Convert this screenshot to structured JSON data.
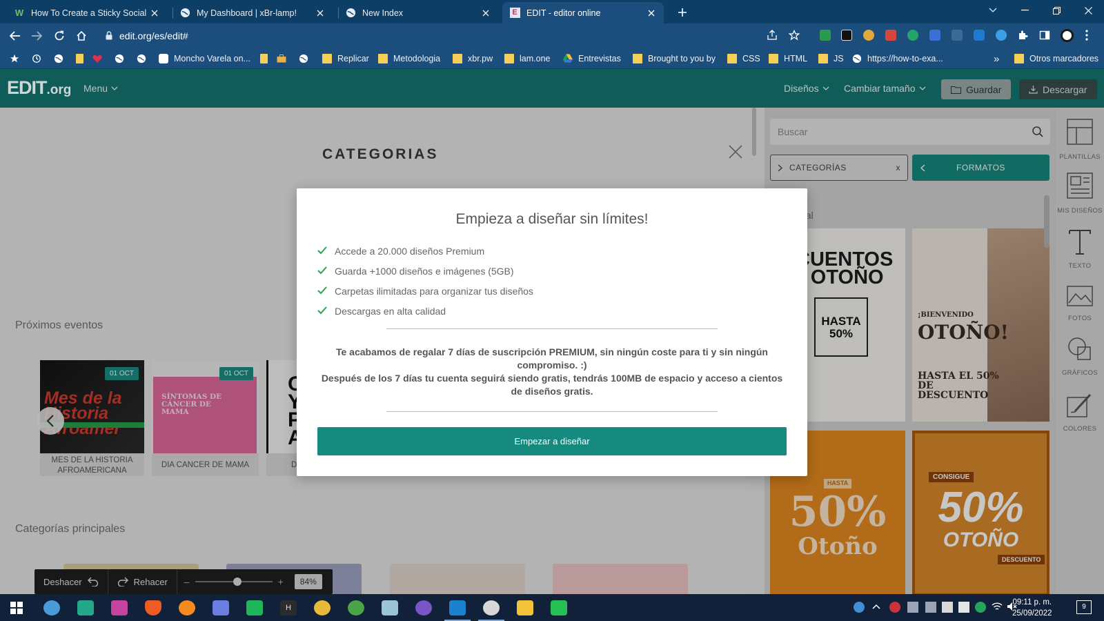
{
  "browser": {
    "tabs": [
      {
        "title": "How To Create a Sticky Social Me",
        "icon": "w-favicon",
        "active": false
      },
      {
        "title": "My Dashboard | xBr-lamp!",
        "icon": "globe-favicon",
        "active": false
      },
      {
        "title": "New Index",
        "icon": "globe-favicon",
        "active": false
      },
      {
        "title": "EDIT - editor online",
        "icon": "edit-favicon",
        "active": true
      }
    ],
    "url": "edit.org/es/edit#",
    "bookmarks": [
      {
        "label": "Moncho Varela on...",
        "icon": "site-icon"
      },
      {
        "label": "Replicar",
        "icon": "folder-icon"
      },
      {
        "label": "Metodologia",
        "icon": "folder-icon"
      },
      {
        "label": "xbr.pw",
        "icon": "folder-icon"
      },
      {
        "label": "lam.one",
        "icon": "folder-icon"
      },
      {
        "label": "Entrevistas",
        "icon": "drive-icon"
      },
      {
        "label": "Brought to you by",
        "icon": "folder-icon"
      },
      {
        "label": "CSS",
        "icon": "folder-icon"
      },
      {
        "label": "HTML",
        "icon": "folder-icon"
      },
      {
        "label": "JS",
        "icon": "folder-icon"
      },
      {
        "label": "https://how-to-exa...",
        "icon": "globe-icon"
      }
    ],
    "bookmarks_overflow": "»",
    "other_bookmarks": "Otros marcadores"
  },
  "app": {
    "logo_main": "EDIT",
    "logo_suffix": ".org",
    "menu": "Menu",
    "designs": "Diseños",
    "resize": "Cambiar tamaño",
    "save": "Guardar",
    "download": "Descargar"
  },
  "workspace": {
    "categories_title": "CATEGORIAS",
    "upcoming_events": "Próximos eventos",
    "main_categories": "Categorías principales",
    "events": [
      {
        "label": "MES DE LA HISTORIA AFROAMERICANA",
        "badge": "01 OCT",
        "art": "Mes de la Historia Afroamer"
      },
      {
        "label": "DIA CANCER DE MAMA",
        "badge": "01 OCT",
        "art": "SÍNTOMAS DE CÁNCER DE MAMA"
      },
      {
        "label": "D",
        "badge": "",
        "art": "OY PA"
      }
    ]
  },
  "editor_bar": {
    "undo": "Deshacer",
    "redo": "Rehacer",
    "zoom": "84%",
    "zoom_level": 0.55
  },
  "panel": {
    "search_placeholder": "Buscar",
    "chip_categories": "CATEGORÍAS",
    "chip_close": "x",
    "chip_formats": "FORMATOS",
    "section_partial": "nal",
    "templates": [
      {
        "text1": "SCUENTOS",
        "text2": "E OTOÑO",
        "text3": "HASTA 50%"
      },
      {
        "text1": "¡BIENVENIDO",
        "text2": "OTOÑO!",
        "text3": "HASTA EL 50% DE DESCUENTO"
      },
      {
        "text1": "HASTA",
        "text2": "50%",
        "text3": "Otoño"
      },
      {
        "text1": "CONSIGUE",
        "text2": "50%",
        "text3": "OTOÑO",
        "text4": "DESCUENTO"
      }
    ],
    "tools": [
      {
        "label": "PLANTILLAS",
        "icon": "templates-icon"
      },
      {
        "label": "MIS DISEÑOS",
        "icon": "my-designs-icon"
      },
      {
        "label": "TEXTO",
        "icon": "text-icon"
      },
      {
        "label": "FOTOS",
        "icon": "photos-icon"
      },
      {
        "label": "GRÁFICOS",
        "icon": "graphics-icon"
      },
      {
        "label": "COLORES",
        "icon": "colors-icon"
      }
    ]
  },
  "modal": {
    "title": "Empieza a diseñar sin límites!",
    "benefits": [
      "Accede a 20.000 diseños Premium",
      "Guarda +1000 diseños e imágenes (5GB)",
      "Carpetas ilimitadas para organizar tus diseños",
      "Descargas en alta calidad"
    ],
    "promo_line1": "Te acabamos de regalar 7 días de suscripción PREMIUM, sin ningún coste para ti y sin ningún compromiso. :)",
    "promo_line2": "Después de los 7 días tu cuenta seguirá siendo gratis, tendrás 100MB de espacio y acceso a cientos de diseños gratis.",
    "cta": "Empezar a diseñar"
  },
  "taskbar": {
    "time": "09:11 p. m.",
    "date": "25/09/2022",
    "notifications": "9"
  },
  "colors": {
    "app_header": "#0f5c59",
    "accent": "#178a7f",
    "browser_frame": "#1c4e7d"
  }
}
